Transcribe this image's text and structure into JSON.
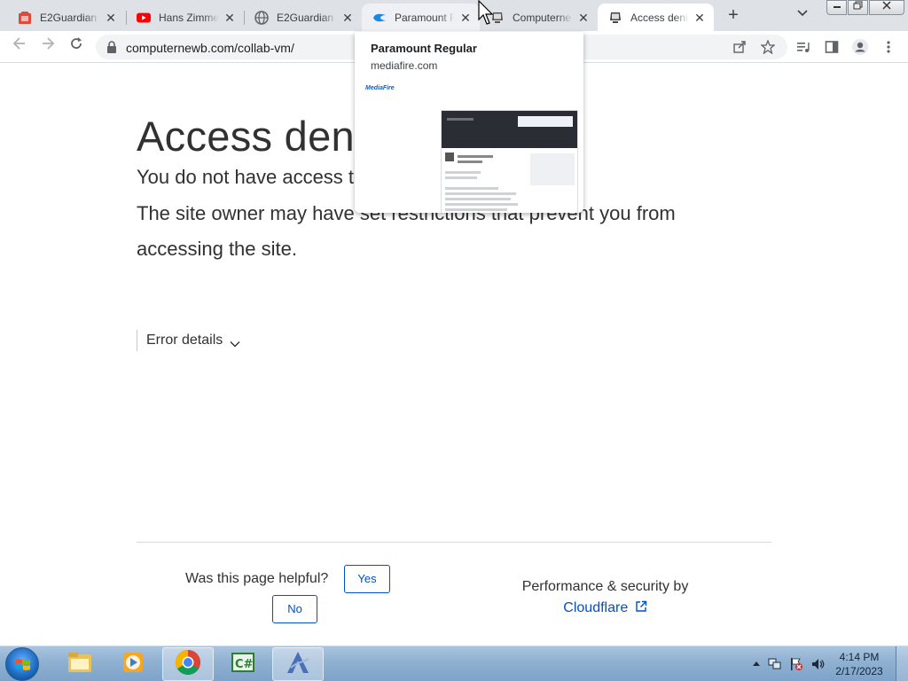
{
  "browser": {
    "tabs": [
      {
        "title": "E2Guardian - ",
        "icon": "e2guardian-icon"
      },
      {
        "title": "Hans Zimmer",
        "icon": "youtube-icon"
      },
      {
        "title": "E2Guardian - ",
        "icon": "globe-icon"
      },
      {
        "title": "Paramount R",
        "icon": "mediafire-icon"
      },
      {
        "title": "Computerne",
        "icon": "computernewb-icon"
      },
      {
        "title": "Access denie",
        "icon": "computernewb-icon"
      }
    ],
    "close_glyph": "✕",
    "new_tab_glyph": "+",
    "url": "computernewb.com/collab-vm/"
  },
  "hover_card": {
    "title": "Paramount Regular",
    "domain": "mediafire.com",
    "logo_text": "MediaFire"
  },
  "page": {
    "heading": "Access denied",
    "line1": "You do not have access to computernewb.com.",
    "line2": "The site owner may have set restrictions that prevent you from",
    "line3": "accessing the site.",
    "error_details": "Error details",
    "helpful_question": "Was this page helpful?",
    "yes_label": "Yes",
    "no_label": "No",
    "perf_text": "Performance & security by",
    "cloudflare": "Cloudflare"
  },
  "taskbar": {
    "time": "4:14 PM",
    "date": "2/17/2023"
  },
  "colors": {
    "accent": "#0051c3",
    "tabstrip": "#dee1e6",
    "taskbar": "#8fb0d1"
  }
}
